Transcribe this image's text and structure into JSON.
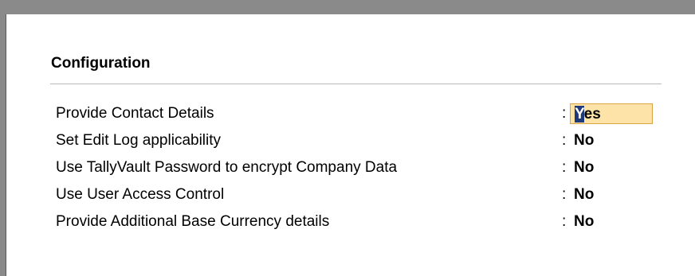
{
  "section": {
    "title": "Configuration"
  },
  "fields": [
    {
      "label": "Provide Contact Details",
      "separator": ":",
      "value": "Yes",
      "value_first": "Y",
      "value_rest": "es",
      "focused": true
    },
    {
      "label": "Set Edit Log applicability",
      "separator": ":",
      "value": "No"
    },
    {
      "label": "Use TallyVault Password to encrypt Company Data",
      "separator": ":",
      "value": "No"
    },
    {
      "label": "Use User Access Control",
      "separator": ":",
      "value": "No"
    },
    {
      "label": "Provide Additional Base Currency details",
      "separator": ":",
      "value": "No"
    }
  ],
  "colors": {
    "frame": "#8a8a8a",
    "focused_field_bg": "#fde3a7",
    "cursor_bg": "#1f3a7a"
  }
}
